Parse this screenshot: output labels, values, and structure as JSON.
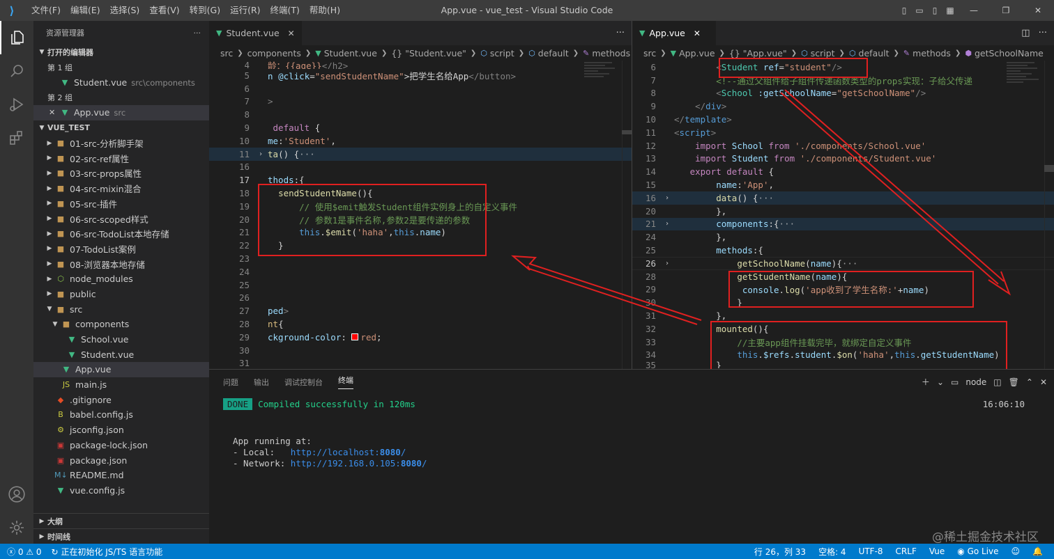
{
  "titlebar": {
    "menu": [
      "文件(F)",
      "编辑(E)",
      "选择(S)",
      "查看(V)",
      "转到(G)",
      "运行(R)",
      "终端(T)",
      "帮助(H)"
    ],
    "title": "App.vue - vue_test - Visual Studio Code"
  },
  "sidebar": {
    "header": "资源管理器",
    "open_editors": "打开的编辑器",
    "group1": "第 1 组",
    "group1_file": "Student.vue",
    "group1_hint": "src\\components",
    "group2": "第 2 组",
    "group2_file": "App.vue",
    "group2_hint": "src",
    "project": "VUE_TEST",
    "tree": [
      {
        "name": "01-src-分析脚手架"
      },
      {
        "name": "02-src-ref属性"
      },
      {
        "name": "03-src-props属性"
      },
      {
        "name": "04-src-mixin混合"
      },
      {
        "name": "05-src-插件"
      },
      {
        "name": "06-src-scoped样式"
      },
      {
        "name": "06-src-TodoList本地存储"
      },
      {
        "name": "07-TodoList案例"
      },
      {
        "name": "08-浏览器本地存储"
      },
      {
        "name": "node_modules"
      },
      {
        "name": "public"
      },
      {
        "name": "src"
      },
      {
        "name": "components"
      },
      {
        "name": "School.vue"
      },
      {
        "name": "Student.vue"
      },
      {
        "name": "App.vue"
      },
      {
        "name": "main.js"
      },
      {
        "name": ".gitignore"
      },
      {
        "name": "babel.config.js"
      },
      {
        "name": "jsconfig.json"
      },
      {
        "name": "package-lock.json"
      },
      {
        "name": "package.json"
      },
      {
        "name": "README.md"
      },
      {
        "name": "vue.config.js"
      }
    ],
    "outline": "大纲",
    "timeline": "时间线"
  },
  "editor1": {
    "tab": "Student.vue",
    "crumbs": [
      "src",
      "components",
      "Student.vue",
      "{} \"Student.vue\"",
      "script",
      "default",
      "methods"
    ]
  },
  "editor2": {
    "tab": "App.vue",
    "crumbs": [
      "src",
      "App.vue",
      "{} \"App.vue\"",
      "script",
      "default",
      "methods",
      "getSchoolName"
    ]
  },
  "panel": {
    "tabs": [
      "问题",
      "输出",
      "调试控制台",
      "终端"
    ],
    "shell": "node",
    "done": "DONE",
    "compiled": "Compiled successfully in 120ms",
    "time": "16:06:10",
    "running": "App running at:",
    "local_label": "- Local:   ",
    "local_url": "http://localhost:",
    "local_port": "8080",
    "network_label": "- Network: ",
    "network_url": "http://192.168.0.105:",
    "network_port": "8080",
    "slash": "/"
  },
  "statusbar": {
    "errors": "0",
    "warnings": "0",
    "message": "正在初始化 JS/TS 语言功能",
    "position": "行 26，列 33",
    "spaces": "空格: 4",
    "encoding": "UTF-8",
    "eol": "CRLF",
    "lang": "Vue",
    "live": "Go Live"
  },
  "watermark": "@稀土掘金技术社区"
}
